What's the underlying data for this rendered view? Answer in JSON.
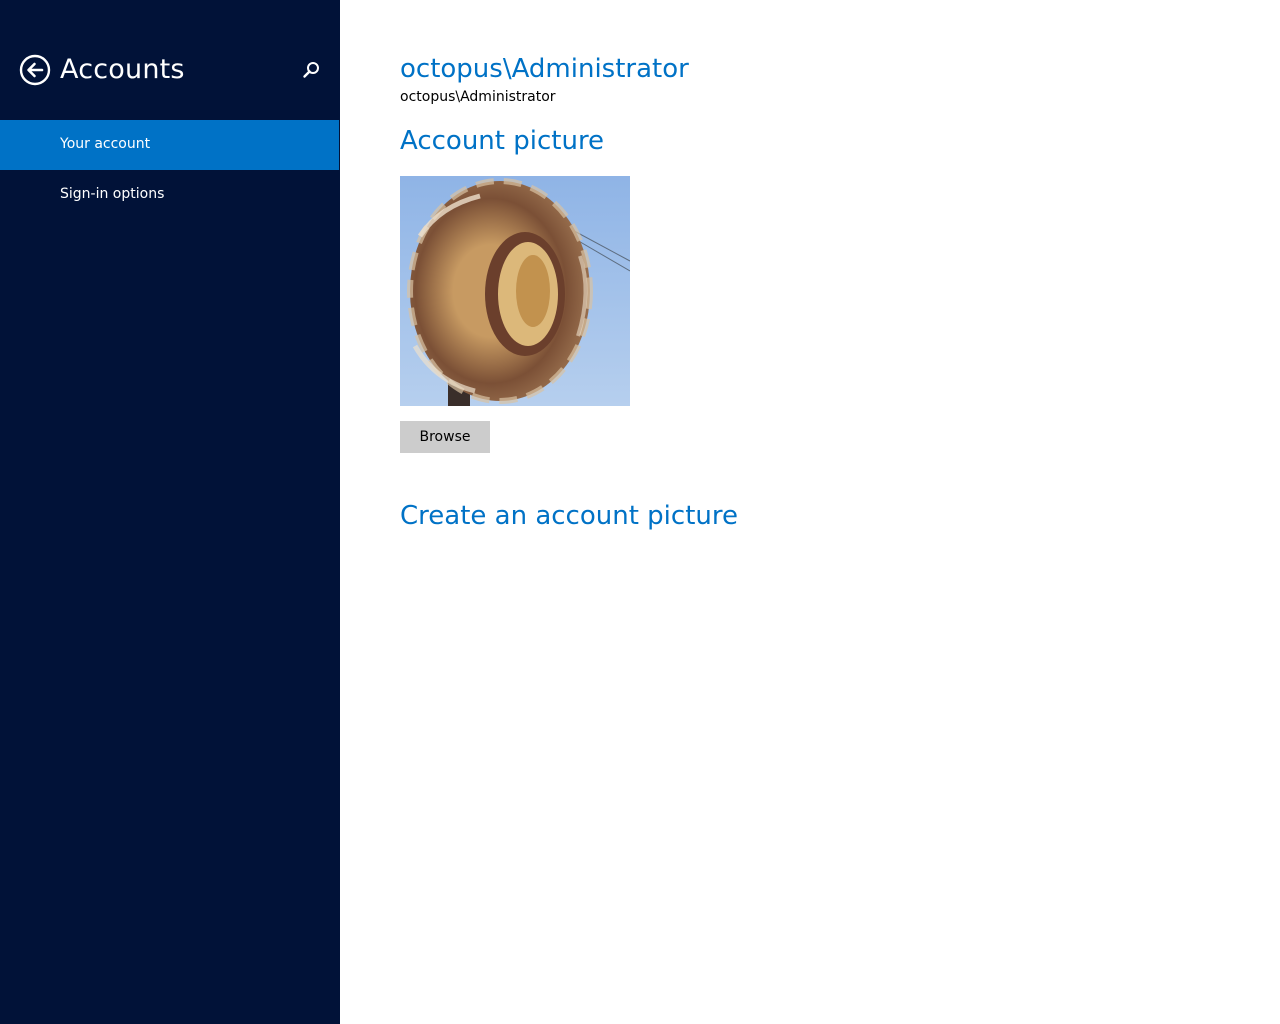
{
  "sidebar": {
    "title": "Accounts",
    "back_icon": "back-arrow-circle-icon",
    "search_icon": "search-icon",
    "items": [
      {
        "label": "Your account",
        "selected": true
      },
      {
        "label": "Sign-in options",
        "selected": false
      }
    ]
  },
  "main": {
    "user_name": "octopus\\Administrator",
    "user_subtitle": "octopus\\Administrator",
    "account_picture_heading": "Account picture",
    "browse_label": "Browse",
    "create_picture_link": "Create an account picture"
  },
  "colors": {
    "sidebar_bg": "#011238",
    "accent": "#0072c6",
    "button_bg": "#cccccc"
  }
}
